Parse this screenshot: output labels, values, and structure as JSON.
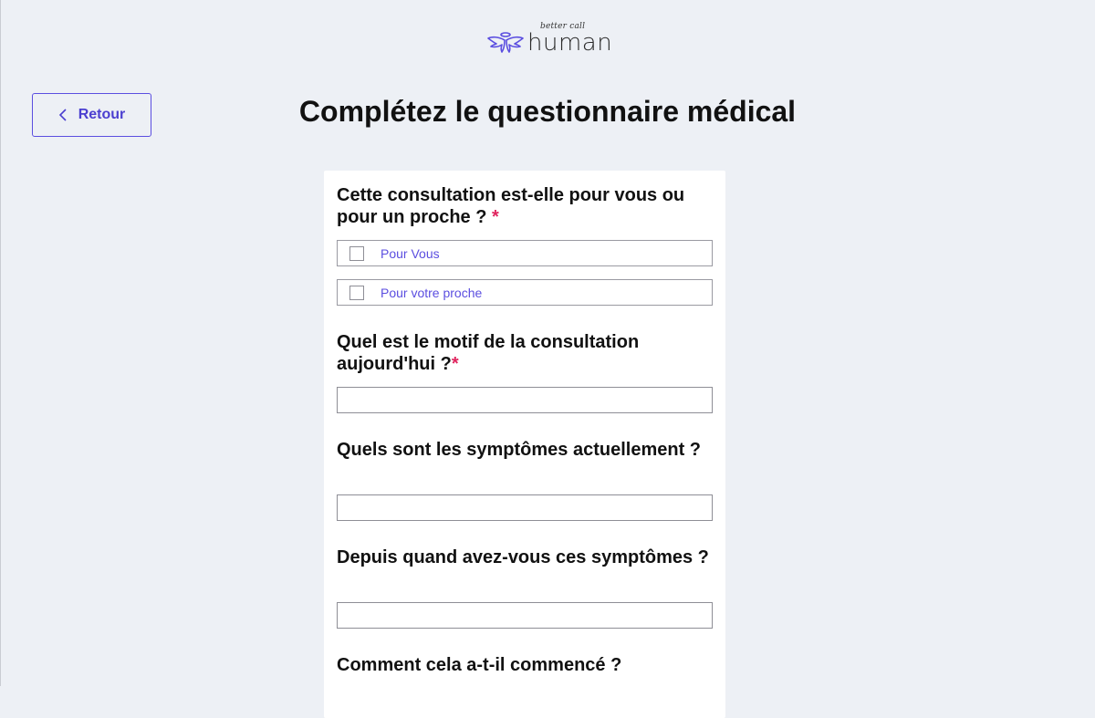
{
  "brand": {
    "tagline": "better call",
    "name": "human"
  },
  "header": {
    "back_label": "Retour",
    "title": "Complétez le questionnaire médical"
  },
  "form": {
    "questions": [
      {
        "label": "Cette consultation est-elle pour vous ou pour un proche ?",
        "required_mark": "*",
        "options": [
          "Pour Vous",
          "Pour votre proche"
        ]
      },
      {
        "label": "Quel est le motif de la consultation aujourd'hui ?",
        "required_mark": "*",
        "value": "",
        "placeholder": ""
      },
      {
        "label": "Quels sont les symptômes actuellement ?",
        "value": "",
        "placeholder": ""
      },
      {
        "label": "Depuis quand avez-vous ces symptômes ?",
        "value": "",
        "placeholder": ""
      },
      {
        "label": "Comment cela a-t-il commencé ?"
      }
    ]
  },
  "colors": {
    "accent": "#5b4ee0",
    "required": "#e0245e",
    "background": "#edf0f5"
  }
}
